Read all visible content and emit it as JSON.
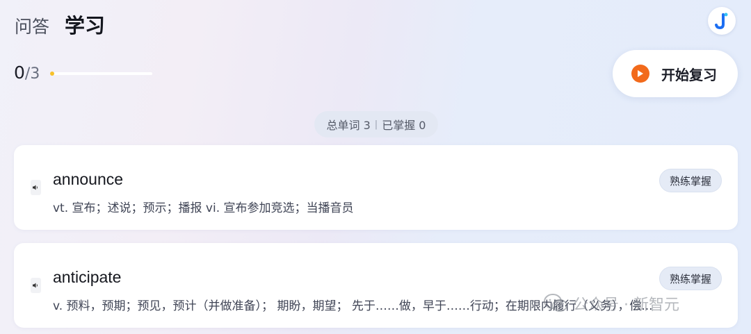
{
  "header": {
    "tabs": [
      {
        "label": "问答",
        "active": false
      },
      {
        "label": "学习",
        "active": true
      }
    ]
  },
  "progress": {
    "current": "0",
    "separator": "/",
    "total": "3",
    "fraction": 0
  },
  "review_button": {
    "label": "开始复习",
    "icon": "play-icon",
    "accent": "#f26a1b"
  },
  "stats": {
    "total_words_label": "总单词 3",
    "separator": "|",
    "mastered_label": "已掌握 0"
  },
  "words": [
    {
      "word": "announce",
      "definition": "vt. 宣布；述说；预示；播报 vi. 宣布参加竞选；当播音员",
      "action_label": "熟练掌握",
      "speaker_icon": "speaker-icon"
    },
    {
      "word": "anticipate",
      "definition": "v. 预料，预期；预见，预计（并做准备）； 期盼，期望； 先于……做，早于……行动；在期限内履行（义务），偿...",
      "action_label": "熟练掌握",
      "speaker_icon": "speaker-icon"
    }
  ],
  "watermark": {
    "text": "公众号 · 新智元",
    "icon": "wechat-icon"
  },
  "colors": {
    "progress_fill": "#f7c12b",
    "avatar_accent": "#1c6ef2"
  }
}
